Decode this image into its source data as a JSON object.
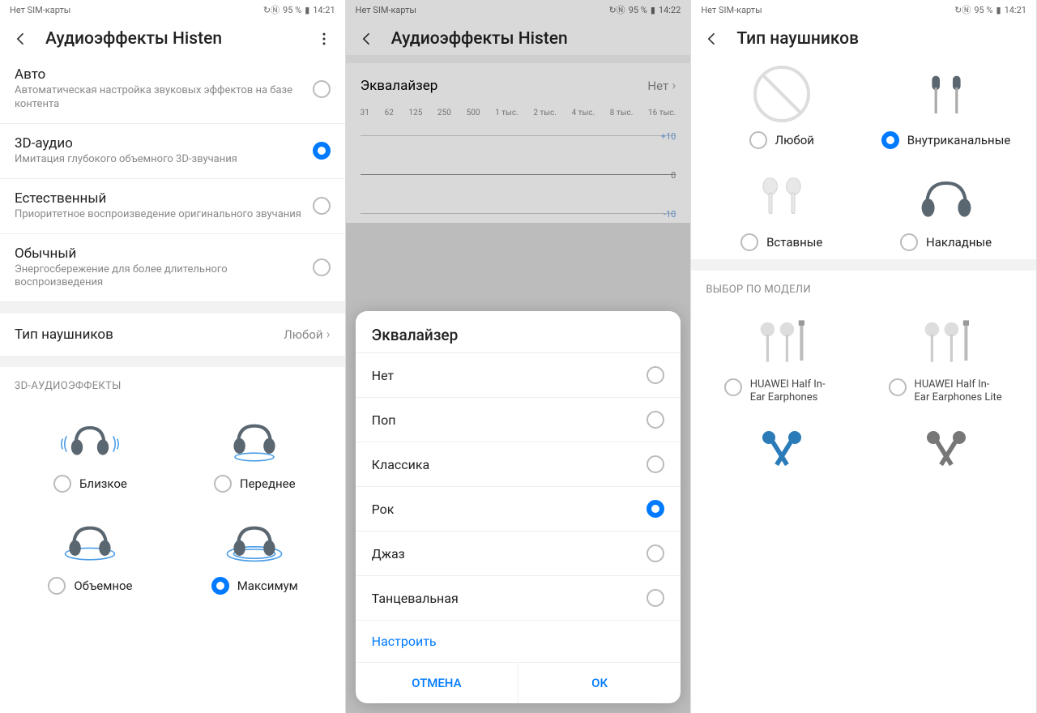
{
  "statusbar": {
    "sim": "Нет SIM-карты",
    "battery": "95 %",
    "time1": "14:21",
    "time2": "14:22",
    "time3": "14:21",
    "nfc": "N"
  },
  "screen1": {
    "title": "Аудиоэффекты Histen",
    "modes": [
      {
        "title": "Авто",
        "sub": "Автоматическая настройка звуковых эффектов на базе контента",
        "checked": false
      },
      {
        "title": "3D-аудио",
        "sub": "Имитация глубокого объемного 3D-звучания",
        "checked": true
      },
      {
        "title": "Естественный",
        "sub": "Приоритетное воспроизведение оригинального звучания",
        "checked": false
      },
      {
        "title": "Обычный",
        "sub": "Энергосбережение для более длительного воспроизведения",
        "checked": false
      }
    ],
    "headphone_type_label": "Тип наушников",
    "headphone_type_value": "Любой",
    "effects_label": "3D-АУДИОЭФФЕКТЫ",
    "effects": [
      {
        "label": "Близкое",
        "checked": false
      },
      {
        "label": "Переднее",
        "checked": false
      },
      {
        "label": "Объемное",
        "checked": false
      },
      {
        "label": "Максимум",
        "checked": true
      }
    ]
  },
  "screen2": {
    "title": "Аудиоэффекты Histen",
    "eq_label": "Эквалайзер",
    "eq_value": "Нет",
    "bands": [
      "31",
      "62",
      "125",
      "250",
      "500",
      "1 тыс.",
      "2 тыс.",
      "4 тыс.",
      "8 тыс.",
      "16 тыс."
    ],
    "scale": {
      "top": "+10",
      "mid": "0",
      "bot": "-10"
    },
    "dialog": {
      "title": "Эквалайзер",
      "options": [
        {
          "label": "Нет",
          "checked": false
        },
        {
          "label": "Поп",
          "checked": false
        },
        {
          "label": "Классика",
          "checked": false
        },
        {
          "label": "Рок",
          "checked": true
        },
        {
          "label": "Джаз",
          "checked": false
        },
        {
          "label": "Танцевальная",
          "checked": false
        }
      ],
      "customize": "Настроить",
      "cancel": "ОТМЕНА",
      "ok": "ОК"
    }
  },
  "screen3": {
    "title": "Тип наушников",
    "types": [
      {
        "label": "Любой",
        "checked": false
      },
      {
        "label": "Внутриканальные",
        "checked": true
      },
      {
        "label": "Вставные",
        "checked": false
      },
      {
        "label": "Накладные",
        "checked": false
      }
    ],
    "model_label": "ВЫБОР ПО МОДЕЛИ",
    "models": [
      {
        "label": "HUAWEI Half In-Ear Earphones",
        "checked": false
      },
      {
        "label": "HUAWEI Half In-Ear Earphones Lite",
        "checked": false
      }
    ]
  }
}
